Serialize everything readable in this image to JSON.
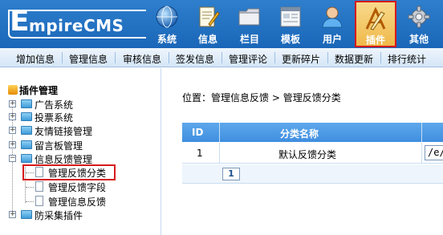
{
  "app": {
    "logo_initial": "E",
    "logo_rest": "mpireCMS"
  },
  "nav": [
    {
      "label": "系统",
      "icon": "globe-icon"
    },
    {
      "label": "信息",
      "icon": "edit-document-icon"
    },
    {
      "label": "栏目",
      "icon": "folder-icon"
    },
    {
      "label": "模板",
      "icon": "template-window-icon"
    },
    {
      "label": "用户",
      "icon": "user-icon"
    },
    {
      "label": "插件",
      "icon": "drawing-tools-icon",
      "active": true
    },
    {
      "label": "其他",
      "icon": "gear-icon"
    }
  ],
  "submenu": [
    "增加信息",
    "管理信息",
    "审核信息",
    "签发信息",
    "管理评论",
    "更新碎片",
    "数据更新",
    "排行统计"
  ],
  "sidebar": {
    "title": "插件管理",
    "items": [
      {
        "label": "广告系统"
      },
      {
        "label": "投票系统"
      },
      {
        "label": "友情链接管理"
      },
      {
        "label": "留言板管理"
      },
      {
        "label": "信息反馈管理",
        "expanded": true
      },
      {
        "label": "管理反馈分类",
        "selected": true
      },
      {
        "label": "管理反馈字段"
      },
      {
        "label": "管理信息反馈"
      },
      {
        "label": "防采集插件"
      }
    ]
  },
  "main": {
    "breadcrumb_prefix": "位置：",
    "breadcrumb_link1": "管理信息反馈",
    "breadcrumb_sep": ">",
    "breadcrumb_link2": "管理反馈分类",
    "table": {
      "headers": [
        "ID",
        "分类名称"
      ],
      "rows": [
        {
          "id": "1",
          "name": "默认反馈分类",
          "path": "/e/t"
        }
      ]
    },
    "pager": {
      "current_page": "1"
    }
  },
  "colors": {
    "header_blue": "#1f6fc2",
    "active_border": "#d61a1a",
    "table_header": "#4a97e4"
  }
}
